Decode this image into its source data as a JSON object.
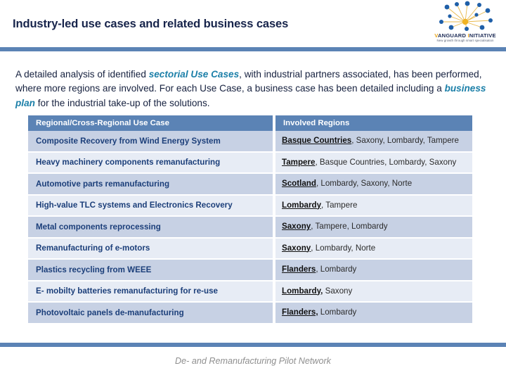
{
  "header": {
    "title": "Industry-led use cases and related business cases",
    "logo": {
      "name_part1": "V",
      "name_part2": "ANGUARD",
      "name_part3": "I",
      "name_part4": "NITIATIVE",
      "tagline": "New growth through smart specialisation"
    }
  },
  "intro": {
    "seg1": "A detailed analysis of identified ",
    "hl1": "sectorial Use Cases",
    "seg2": ", with industrial partners associated, has been performed, where more regions are involved. For each Use Case, a business case has been detailed including a ",
    "hl2": "business plan",
    "seg3": " for the industrial take-up of the solutions."
  },
  "table": {
    "columns": [
      "Regional/Cross-Regional Use Case",
      "Involved Regions"
    ],
    "rows": [
      {
        "use_case": "Composite Recovery from Wind Energy System",
        "lead_region": "Basque Countries",
        "other_regions": ", Saxony, Lombardy, Tampere"
      },
      {
        "use_case": "Heavy machinery components remanufacturing",
        "lead_region": "Tampere",
        "other_regions": ", Basque Countries, Lombardy, Saxony"
      },
      {
        "use_case": "Automotive parts remanufacturing",
        "lead_region": "Scotland",
        "other_regions": ", Lombardy, Saxony, Norte"
      },
      {
        "use_case": "High-value TLC systems and Electronics Recovery",
        "lead_region": "Lombardy",
        "other_regions": ", Tampere"
      },
      {
        "use_case": "Metal components reprocessing",
        "lead_region": "Saxony",
        "other_regions": ", Tampere, Lombardy"
      },
      {
        "use_case": "Remanufacturing of e-motors",
        "lead_region": "Saxony",
        "other_regions": ", Lombardy, Norte"
      },
      {
        "use_case": "Plastics recycling from WEEE",
        "lead_region": "Flanders",
        "other_regions": ", Lombardy"
      },
      {
        "use_case": "E- mobilty batteries remanufacturing for re-use",
        "lead_region": "Lombardy,",
        "other_regions": " Saxony"
      },
      {
        "use_case": "Photovoltaic panels de-manufacturing",
        "lead_region": "Flanders,",
        "other_regions": " Lombardy"
      }
    ]
  },
  "footer": {
    "note": "De- and Remanufacturing Pilot Network"
  },
  "colors": {
    "accent_bar": "#5b83b5",
    "header_fill": "#5b83b5",
    "row_dark": "#c7d1e4",
    "row_light": "#e7ecf5",
    "title_text": "#17244b",
    "highlight_text": "#1b7fa8",
    "use_case_text": "#1c3f7a",
    "footer_text": "#8f8f8f"
  }
}
